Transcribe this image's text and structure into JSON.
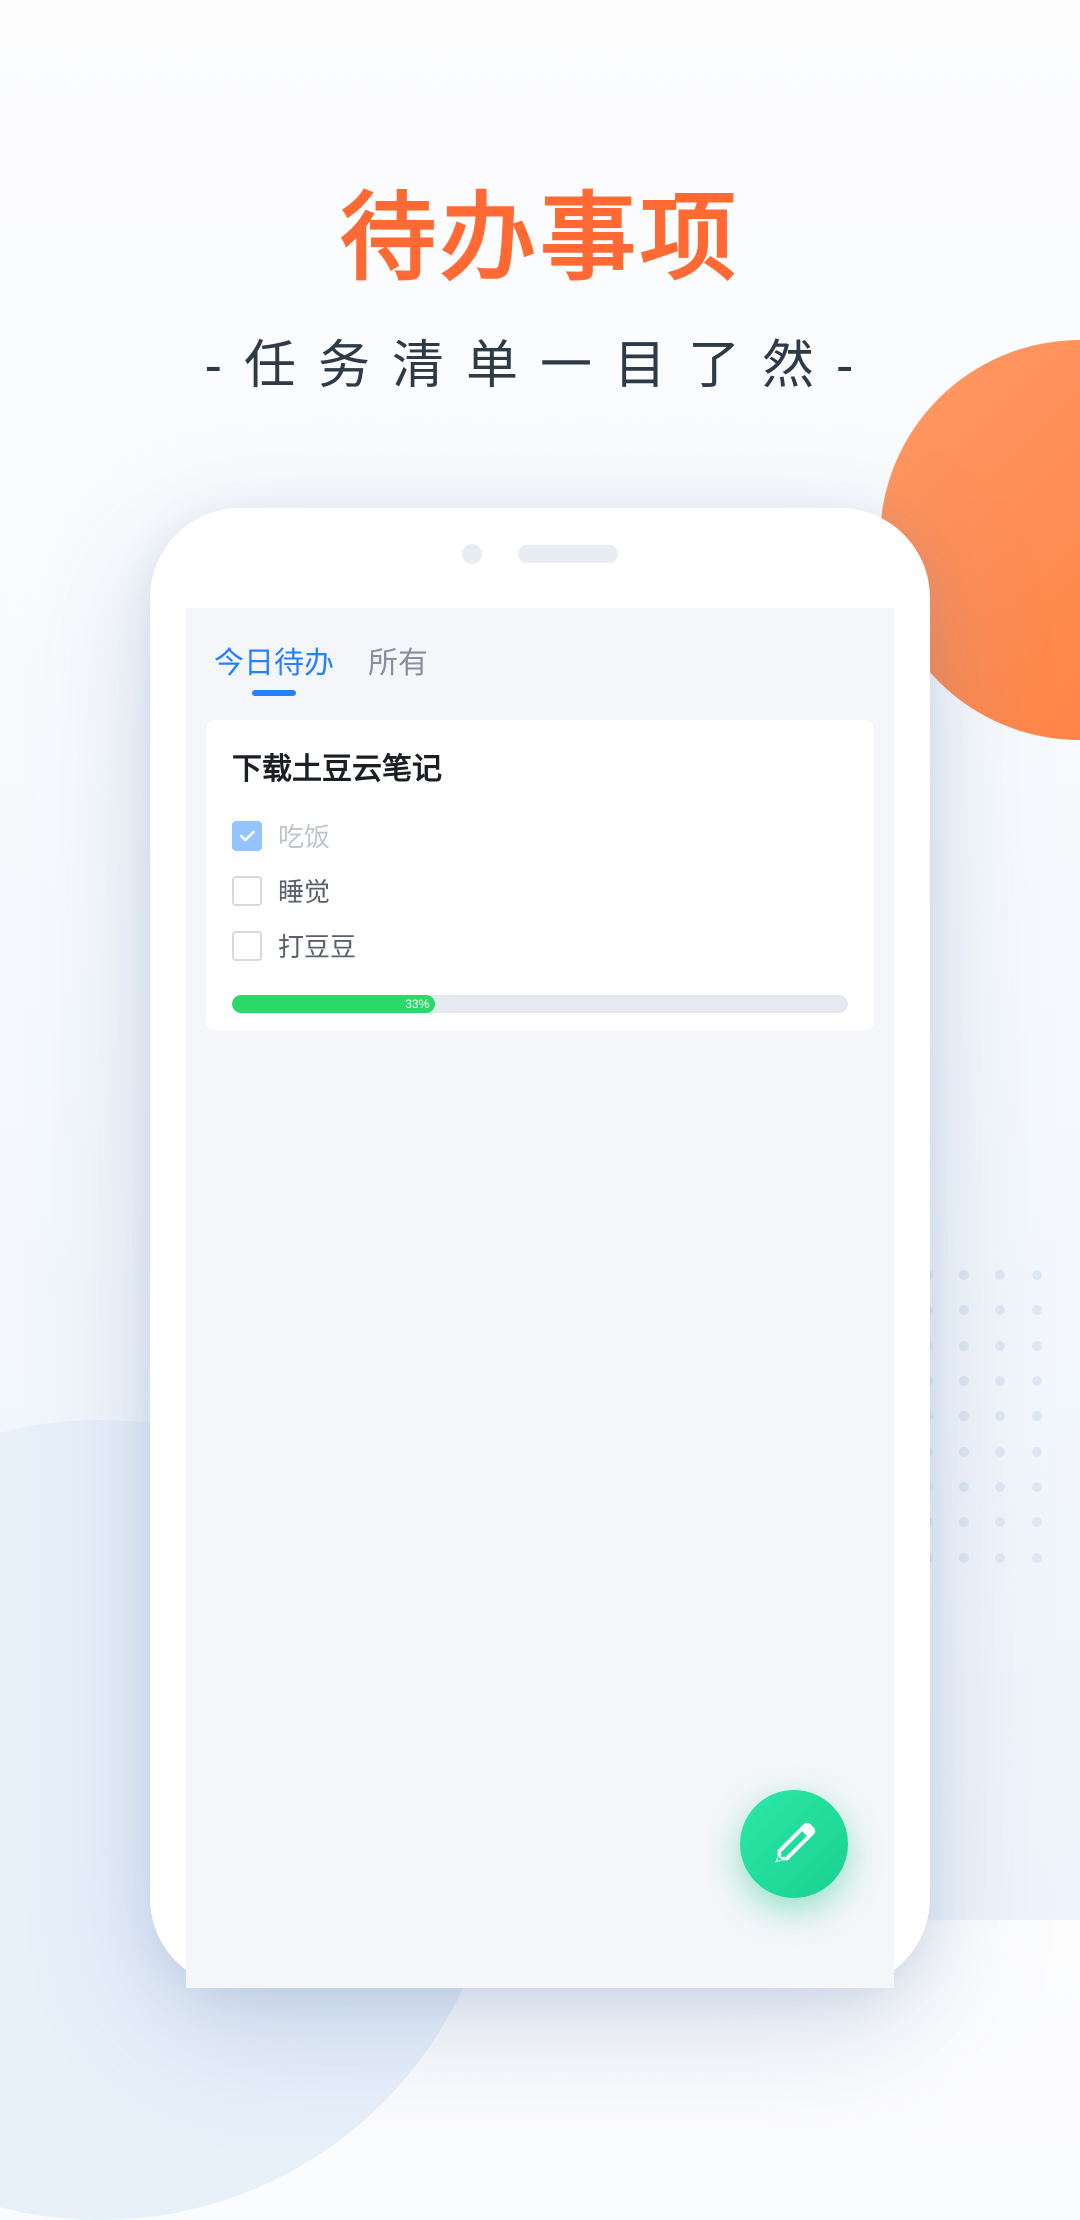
{
  "hero": {
    "title": "待办事项",
    "subtitle": "-任务清单一目了然-"
  },
  "tabs": {
    "today": "今日待办",
    "all": "所有"
  },
  "card": {
    "title": "下载土豆云笔记",
    "todos": [
      {
        "label": "吃饭",
        "checked": true
      },
      {
        "label": "睡觉",
        "checked": false
      },
      {
        "label": "打豆豆",
        "checked": false
      }
    ],
    "progress": {
      "percent": 33,
      "label": "33%"
    }
  }
}
